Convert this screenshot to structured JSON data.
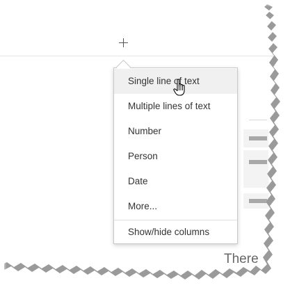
{
  "header": {
    "add_column_icon": "plus-icon"
  },
  "menu": {
    "items": [
      {
        "label": "Single line of text",
        "state": "hover"
      },
      {
        "label": "Multiple lines of text"
      },
      {
        "label": "Number"
      },
      {
        "label": "Person"
      },
      {
        "label": "Date"
      },
      {
        "label": "More..."
      }
    ],
    "footer_item": {
      "label": "Show/hide columns"
    }
  },
  "background": {
    "partial_text": "There"
  },
  "cursor": {
    "icon": "hand-pointer-icon"
  }
}
